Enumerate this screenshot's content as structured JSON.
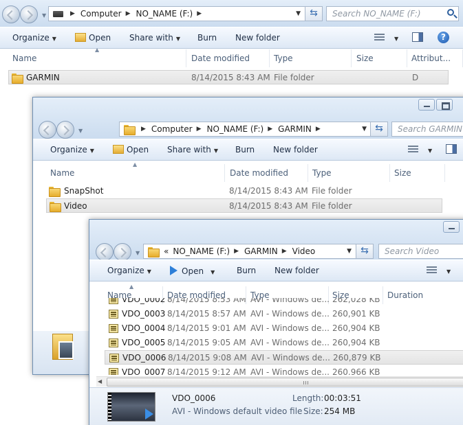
{
  "window1": {
    "address": [
      "Computer",
      "NO_NAME (F:)"
    ],
    "search_placeholder": "Search NO_NAME (F:)",
    "toolbar": {
      "organize": "Organize",
      "open": "Open",
      "share_with": "Share with",
      "burn": "Burn",
      "new_folder": "New folder"
    },
    "columns": {
      "name": "Name",
      "date_modified": "Date modified",
      "type": "Type",
      "size": "Size",
      "attributes": "Attribut..."
    },
    "rows": [
      {
        "name": "GARMIN",
        "date": "8/14/2015 8:43 AM",
        "type": "File folder",
        "attr": "D"
      }
    ]
  },
  "window2": {
    "address": [
      "Computer",
      "NO_NAME (F:)",
      "GARMIN"
    ],
    "search_placeholder": "Search GARMIN",
    "toolbar": {
      "organize": "Organize",
      "open": "Open",
      "share_with": "Share with",
      "burn": "Burn",
      "new_folder": "New folder"
    },
    "columns": {
      "name": "Name",
      "date_modified": "Date modified",
      "type": "Type",
      "size": "Size"
    },
    "rows": [
      {
        "name": "SnapShot",
        "date": "8/14/2015 8:43 AM",
        "type": "File folder"
      },
      {
        "name": "Video",
        "date": "8/14/2015 8:43 AM",
        "type": "File folder"
      }
    ]
  },
  "window3": {
    "address_prefix": "«",
    "address": [
      "NO_NAME (F:)",
      "GARMIN",
      "Video"
    ],
    "search_placeholder": "Search Video",
    "toolbar": {
      "organize": "Organize",
      "open": "Open",
      "burn": "Burn",
      "new_folder": "New folder"
    },
    "columns": {
      "name": "Name",
      "date_modified": "Date modified",
      "type": "Type",
      "size": "Size",
      "duration": "Duration"
    },
    "rows": [
      {
        "name": "VDO_0002",
        "date": "8/14/2015 8:53 AM",
        "type": "AVI - Windows de...",
        "size": "262,028 KB"
      },
      {
        "name": "VDO_0003",
        "date": "8/14/2015 8:57 AM",
        "type": "AVI - Windows de...",
        "size": "260,901 KB"
      },
      {
        "name": "VDO_0004",
        "date": "8/14/2015 9:01 AM",
        "type": "AVI - Windows de...",
        "size": "260,904 KB"
      },
      {
        "name": "VDO_0005",
        "date": "8/14/2015 9:05 AM",
        "type": "AVI - Windows de...",
        "size": "260,904 KB"
      },
      {
        "name": "VDO_0006",
        "date": "8/14/2015 9:08 AM",
        "type": "AVI - Windows de...",
        "size": "260,879 KB"
      },
      {
        "name": "VDO_0007",
        "date": "8/14/2015 9:12 AM",
        "type": "AVI - Windows de...",
        "size": "260,966 KB"
      }
    ],
    "details": {
      "filename": "VDO_0006",
      "filetype": "AVI - Windows default video file",
      "length_label": "Length:",
      "length_value": "00:03:51",
      "size_label": "Size:",
      "size_value": "254 MB"
    }
  }
}
